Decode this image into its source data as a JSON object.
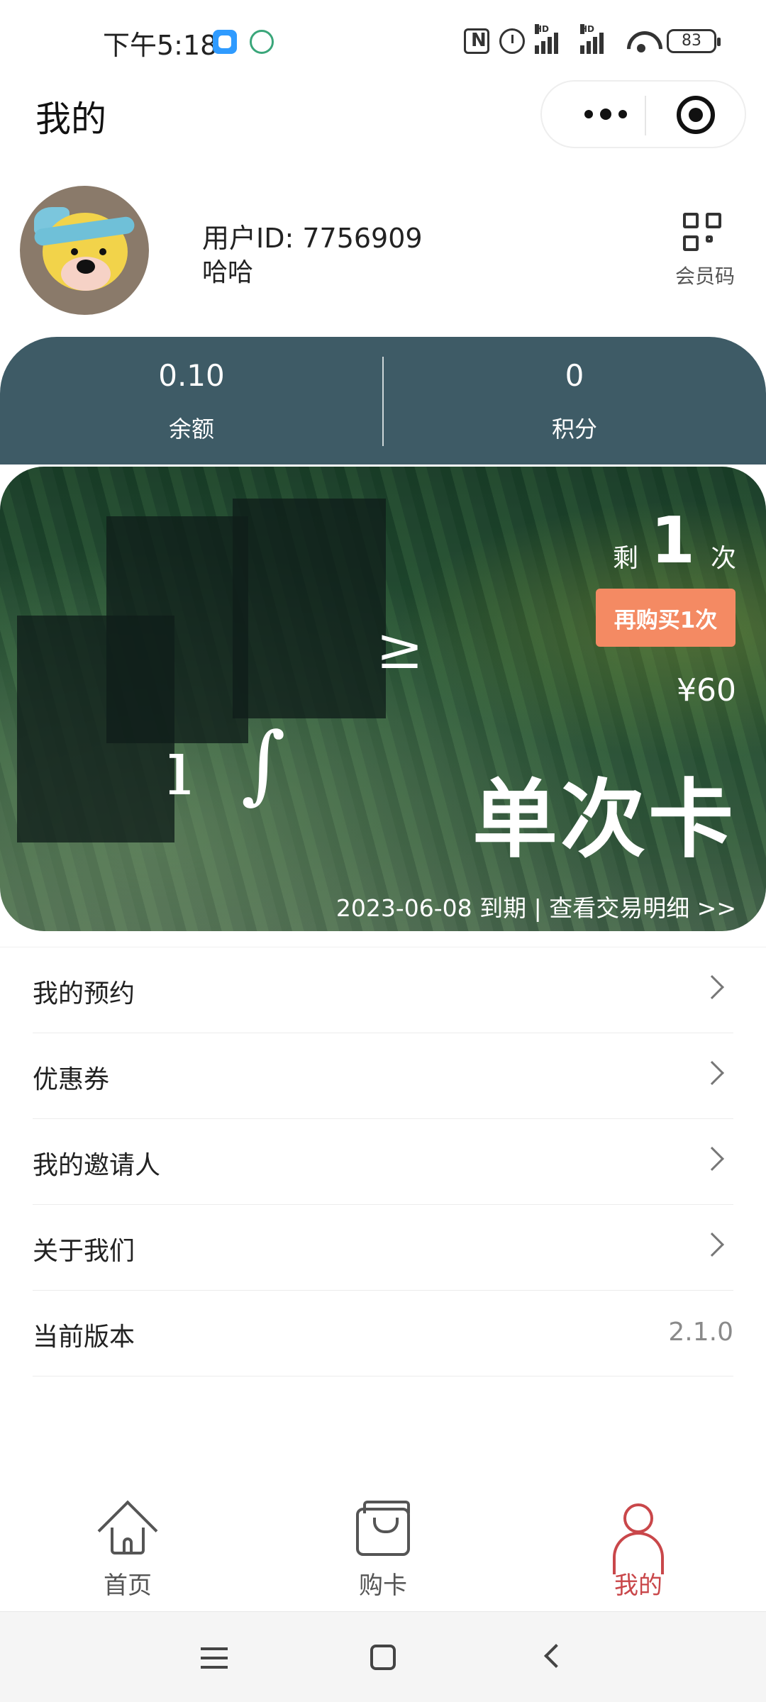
{
  "status_bar": {
    "time": "下午5:18",
    "battery": "83",
    "icons": [
      "app-notification-icon",
      "leaf-app-icon",
      "nfc-icon",
      "alarm-icon",
      "hd-signal-icon",
      "hd-signal-icon",
      "wifi-icon",
      "battery-icon"
    ]
  },
  "header": {
    "title": "我的",
    "capsule_icons": [
      "more-icon",
      "close-target-icon"
    ]
  },
  "profile": {
    "user_id": "用户ID: 7756909",
    "name": "哈哈",
    "qr_label": "会员码"
  },
  "stats": [
    {
      "value": "0.10",
      "label": "余额"
    },
    {
      "value": "0",
      "label": "积分"
    }
  ],
  "card": {
    "remain_prefix": "剩",
    "remain_count": "1",
    "remain_suffix": "次",
    "buy_again": "再购买1次",
    "price": "¥60",
    "name": "单次卡",
    "expiry": "2023-06-08 到期 | 查看交易明细 >>"
  },
  "menu": [
    {
      "label": "我的预约"
    },
    {
      "label": "优惠券"
    },
    {
      "label": "我的邀请人"
    },
    {
      "label": "关于我们"
    },
    {
      "label": "当前版本",
      "value": "2.1.0"
    }
  ],
  "tabbar": [
    {
      "label": "首页",
      "icon": "home-icon"
    },
    {
      "label": "购卡",
      "icon": "shopping-bag-icon"
    },
    {
      "label": "我的",
      "icon": "user-icon",
      "active": true
    }
  ],
  "colors": {
    "stats_bg": "#3e5b66",
    "buy_button": "#f48a63",
    "tab_active": "#c9474a"
  }
}
